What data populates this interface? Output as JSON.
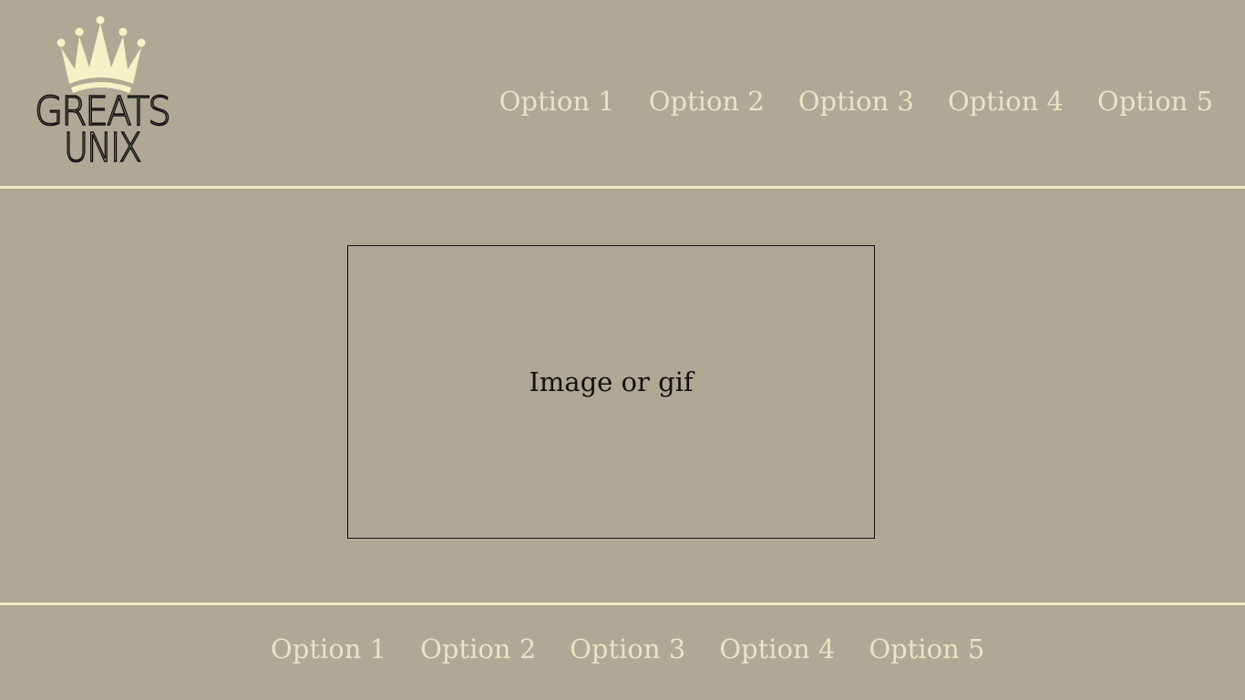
{
  "brand": {
    "logo_line1": "GREATS",
    "logo_line2": "UNIX",
    "crown_color": "#f6f1c6"
  },
  "header_nav": [
    {
      "label": "Option 1"
    },
    {
      "label": "Option 2"
    },
    {
      "label": "Option 3"
    },
    {
      "label": "Option 4"
    },
    {
      "label": "Option 5"
    }
  ],
  "main": {
    "media_placeholder": "Image or gif"
  },
  "footer_nav": [
    {
      "label": "Option 1"
    },
    {
      "label": "Option 2"
    },
    {
      "label": "Option 3"
    },
    {
      "label": "Option 4"
    },
    {
      "label": "Option 5"
    }
  ],
  "colors": {
    "background": "#afa895",
    "nav_text": "#eae3c4",
    "divider": "#f2ecc8"
  }
}
